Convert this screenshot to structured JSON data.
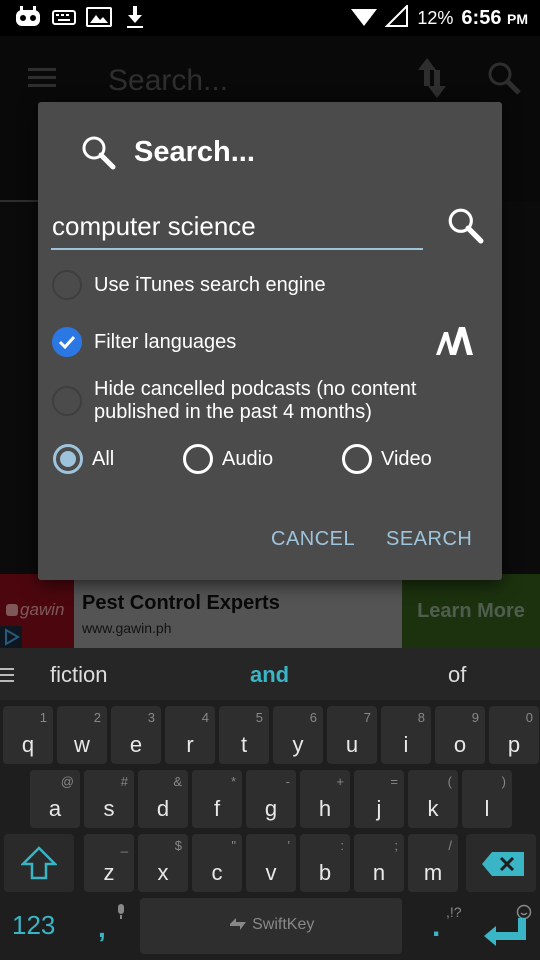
{
  "status_bar": {
    "battery_percent": "12%",
    "time": "6:56",
    "ampm": "PM"
  },
  "app_bar": {
    "title": "Search..."
  },
  "dialog": {
    "title": "Search...",
    "query": "computer science",
    "options": [
      {
        "label": "Use iTunes search engine",
        "checked": false
      },
      {
        "label": "Filter languages",
        "checked": true
      },
      {
        "label": "Hide cancelled podcasts (no content published in the past 4 months)",
        "checked": false
      }
    ],
    "media_types": [
      {
        "label": "All",
        "selected": true
      },
      {
        "label": "Audio",
        "selected": false
      },
      {
        "label": "Video",
        "selected": false
      }
    ],
    "cancel_label": "CANCEL",
    "search_label": "SEARCH"
  },
  "ad": {
    "brand": "gawin",
    "title": "Pest Control Experts",
    "url": "www.gawin.ph",
    "cta": "Learn More"
  },
  "keyboard": {
    "suggestions": [
      "fiction",
      "and",
      "of"
    ],
    "row1": [
      {
        "k": "q",
        "h": "1"
      },
      {
        "k": "w",
        "h": "2"
      },
      {
        "k": "e",
        "h": "3"
      },
      {
        "k": "r",
        "h": "4"
      },
      {
        "k": "t",
        "h": "5"
      },
      {
        "k": "y",
        "h": "6"
      },
      {
        "k": "u",
        "h": "7"
      },
      {
        "k": "i",
        "h": "8"
      },
      {
        "k": "o",
        "h": "9"
      },
      {
        "k": "p",
        "h": "0"
      }
    ],
    "row2": [
      {
        "k": "a",
        "h": "@"
      },
      {
        "k": "s",
        "h": "#"
      },
      {
        "k": "d",
        "h": "&"
      },
      {
        "k": "f",
        "h": "*"
      },
      {
        "k": "g",
        "h": "-"
      },
      {
        "k": "h",
        "h": "+"
      },
      {
        "k": "j",
        "h": "="
      },
      {
        "k": "k",
        "h": "("
      },
      {
        "k": "l",
        "h": ")"
      }
    ],
    "row3": [
      {
        "k": "z",
        "h": "_"
      },
      {
        "k": "x",
        "h": "$"
      },
      {
        "k": "c",
        "h": "\""
      },
      {
        "k": "v",
        "h": "'"
      },
      {
        "k": "b",
        "h": ":"
      },
      {
        "k": "n",
        "h": ";"
      },
      {
        "k": "m",
        "h": "/"
      }
    ],
    "numbers_label": "123",
    "comma": ",",
    "space_label": "SwiftKey",
    "period": ".",
    "period_hint": ",!?"
  },
  "colors": {
    "accent": "#9ec4dc",
    "checkbox_blue": "#2b78e4",
    "keyboard_teal": "#3ab5c6"
  }
}
